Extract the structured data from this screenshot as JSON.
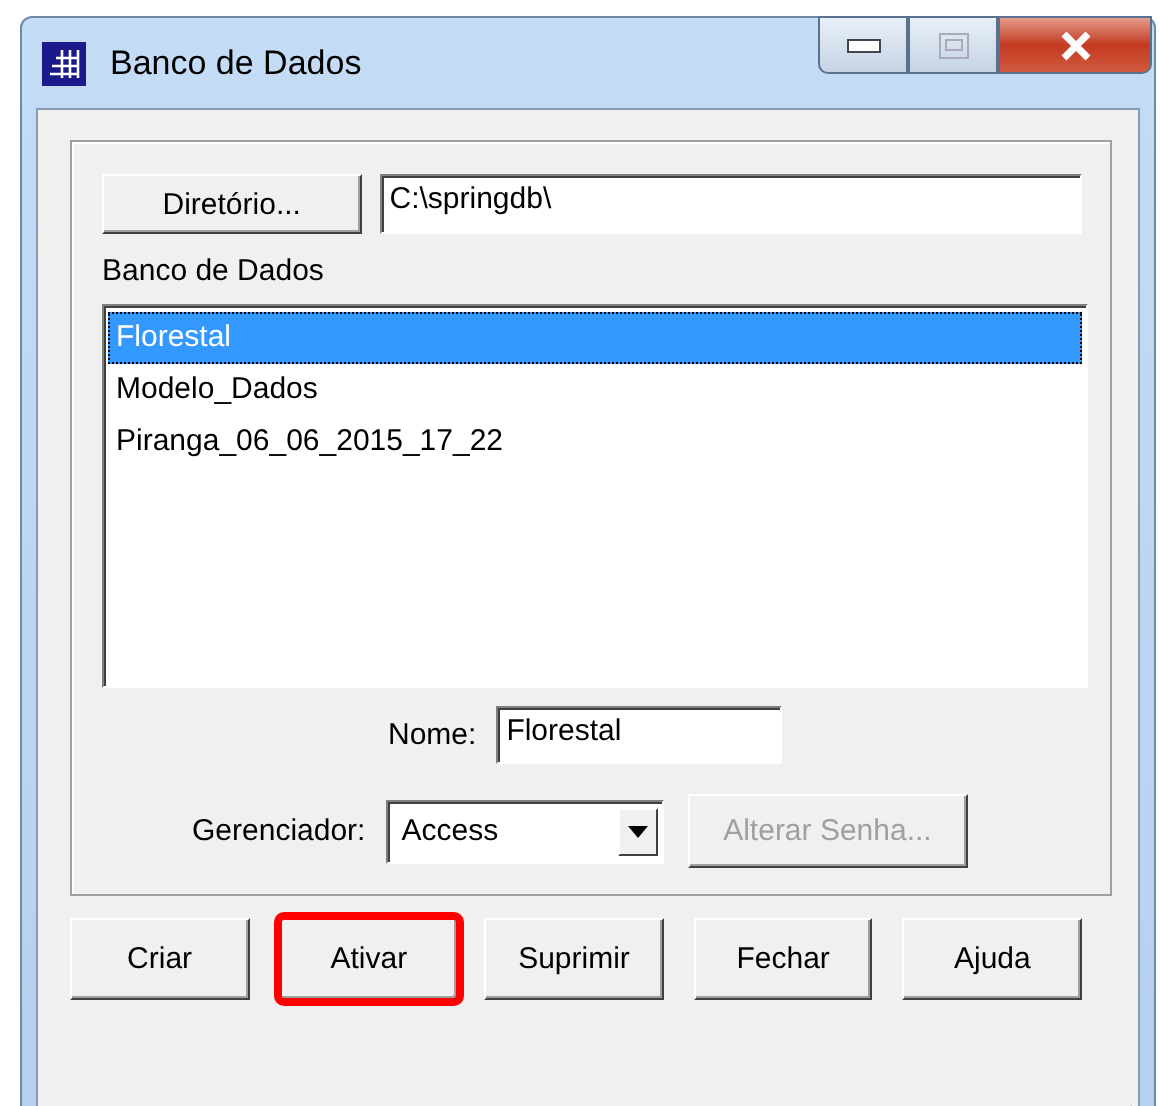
{
  "window": {
    "title": "Banco de Dados"
  },
  "directory": {
    "button": "Diretório...",
    "value": "C:\\springdb\\"
  },
  "database_list": {
    "label": "Banco de Dados",
    "items": [
      {
        "label": "Florestal",
        "selected": true
      },
      {
        "label": "Modelo_Dados",
        "selected": false
      },
      {
        "label": "Piranga_06_06_2015_17_22",
        "selected": false
      }
    ]
  },
  "name_field": {
    "label": "Nome:",
    "value": "Florestal"
  },
  "manager": {
    "label": "Gerenciador:",
    "value": "Access"
  },
  "change_password": {
    "label": "Alterar Senha...",
    "disabled": true
  },
  "buttons": [
    {
      "label": "Criar",
      "highlighted": false
    },
    {
      "label": "Ativar",
      "highlighted": true
    },
    {
      "label": "Suprimir",
      "highlighted": false
    },
    {
      "label": "Fechar",
      "highlighted": false
    },
    {
      "label": "Ajuda",
      "highlighted": false
    }
  ]
}
